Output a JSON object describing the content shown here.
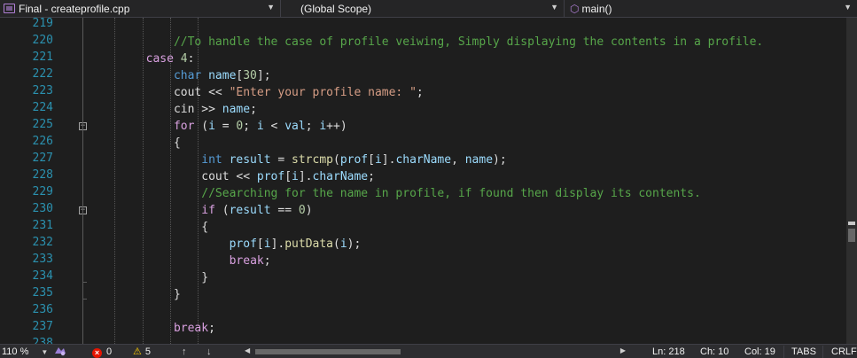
{
  "navbar": {
    "project": "Final - createprofile.cpp",
    "scope": "(Global Scope)",
    "function": "main()",
    "icons": {
      "project": "project-icon",
      "function": "function-cube-icon"
    }
  },
  "editor": {
    "colors": {
      "keyword": "#569cd6",
      "control": "#d8a0df",
      "variable": "#9cdcfe",
      "function": "#dcdcaa",
      "string": "#d69d85",
      "number": "#b5cea8",
      "comment": "#57a64a",
      "line_number": "#2b91af"
    },
    "lines": [
      {
        "n": "219",
        "indent": 0,
        "tokens": []
      },
      {
        "n": "220",
        "indent": 3,
        "tokens": [
          [
            "cmt",
            "//To handle the case of profile veiwing, Simply displaying the contents in a profile."
          ]
        ]
      },
      {
        "n": "221",
        "indent": 2,
        "tokens": [
          [
            "ctl",
            "case"
          ],
          [
            "pl",
            " "
          ],
          [
            "num",
            "4"
          ],
          [
            "pl",
            ":"
          ]
        ]
      },
      {
        "n": "222",
        "indent": 3,
        "tokens": [
          [
            "kw",
            "char"
          ],
          [
            "pl",
            " "
          ],
          [
            "var",
            "name"
          ],
          [
            "pl",
            "["
          ],
          [
            "num",
            "30"
          ],
          [
            "pl",
            "];"
          ]
        ]
      },
      {
        "n": "223",
        "indent": 3,
        "tokens": [
          [
            "pl",
            "cout << "
          ],
          [
            "str",
            "\"Enter your profile name: \""
          ],
          [
            "pl",
            ";"
          ]
        ]
      },
      {
        "n": "224",
        "indent": 3,
        "tokens": [
          [
            "pl",
            "cin >> "
          ],
          [
            "var",
            "name"
          ],
          [
            "pl",
            ";"
          ]
        ]
      },
      {
        "n": "225",
        "indent": 3,
        "tokens": [
          [
            "ctl",
            "for"
          ],
          [
            "pl",
            " ("
          ],
          [
            "var",
            "i"
          ],
          [
            "pl",
            " = "
          ],
          [
            "num",
            "0"
          ],
          [
            "pl",
            "; "
          ],
          [
            "var",
            "i"
          ],
          [
            "pl",
            " < "
          ],
          [
            "var",
            "val"
          ],
          [
            "pl",
            "; "
          ],
          [
            "var",
            "i"
          ],
          [
            "pl",
            "++)"
          ]
        ]
      },
      {
        "n": "226",
        "indent": 3,
        "tokens": [
          [
            "pl",
            "{"
          ]
        ]
      },
      {
        "n": "227",
        "indent": 4,
        "tokens": [
          [
            "kw",
            "int"
          ],
          [
            "pl",
            " "
          ],
          [
            "var",
            "result"
          ],
          [
            "pl",
            " = "
          ],
          [
            "fn",
            "strcmp"
          ],
          [
            "pl",
            "("
          ],
          [
            "var",
            "prof"
          ],
          [
            "pl",
            "["
          ],
          [
            "var",
            "i"
          ],
          [
            "pl",
            "]."
          ],
          [
            "var",
            "charName"
          ],
          [
            "pl",
            ", "
          ],
          [
            "var",
            "name"
          ],
          [
            "pl",
            ");"
          ]
        ]
      },
      {
        "n": "228",
        "indent": 4,
        "tokens": [
          [
            "pl",
            "cout << "
          ],
          [
            "var",
            "prof"
          ],
          [
            "pl",
            "["
          ],
          [
            "var",
            "i"
          ],
          [
            "pl",
            "]."
          ],
          [
            "var",
            "charName"
          ],
          [
            "pl",
            ";"
          ]
        ]
      },
      {
        "n": "229",
        "indent": 4,
        "tokens": [
          [
            "cmt",
            "//Searching for the name in profile, if found then display its contents."
          ]
        ]
      },
      {
        "n": "230",
        "indent": 4,
        "tokens": [
          [
            "ctl",
            "if"
          ],
          [
            "pl",
            " ("
          ],
          [
            "var",
            "result"
          ],
          [
            "pl",
            " == "
          ],
          [
            "num",
            "0"
          ],
          [
            "pl",
            ")"
          ]
        ]
      },
      {
        "n": "231",
        "indent": 4,
        "tokens": [
          [
            "pl",
            "{"
          ]
        ]
      },
      {
        "n": "232",
        "indent": 5,
        "tokens": [
          [
            "var",
            "prof"
          ],
          [
            "pl",
            "["
          ],
          [
            "var",
            "i"
          ],
          [
            "pl",
            "]."
          ],
          [
            "fn",
            "putData"
          ],
          [
            "pl",
            "("
          ],
          [
            "var",
            "i"
          ],
          [
            "pl",
            ");"
          ]
        ]
      },
      {
        "n": "233",
        "indent": 5,
        "tokens": [
          [
            "ctl",
            "break"
          ],
          [
            "pl",
            ";"
          ]
        ]
      },
      {
        "n": "234",
        "indent": 4,
        "tokens": [
          [
            "pl",
            "}"
          ]
        ]
      },
      {
        "n": "235",
        "indent": 3,
        "tokens": [
          [
            "pl",
            "}"
          ]
        ]
      },
      {
        "n": "236",
        "indent": 0,
        "tokens": []
      },
      {
        "n": "237",
        "indent": 3,
        "tokens": [
          [
            "ctl",
            "break"
          ],
          [
            "pl",
            ";"
          ]
        ]
      },
      {
        "n": "238",
        "indent": 0,
        "tokens": []
      }
    ]
  },
  "statusbar": {
    "zoom": "110 %",
    "errors": "0",
    "warnings": "5",
    "position": {
      "line": "Ln: 218",
      "col_char": "Ch: 10",
      "col": "Col: 19"
    },
    "indent_mode": "TABS",
    "line_ending": "CRLF",
    "icons": {
      "error": "error-icon",
      "warning": "warning-icon",
      "live_share": "live-share-icon"
    }
  }
}
